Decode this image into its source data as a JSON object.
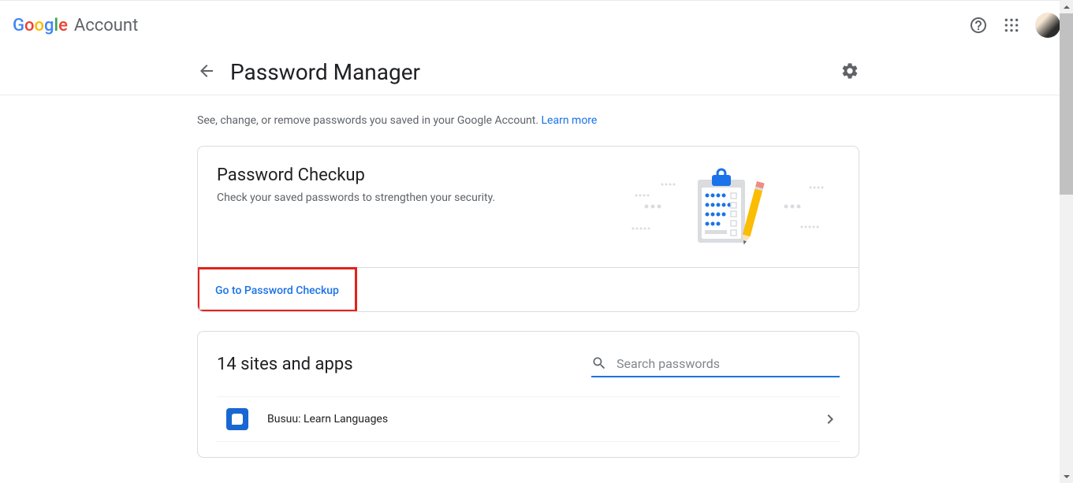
{
  "header": {
    "logo_text": "Google",
    "account_label": "Account"
  },
  "page": {
    "title": "Password Manager",
    "intro_text": "See, change, or remove passwords you saved in your Google Account. ",
    "intro_link": "Learn more"
  },
  "checkup": {
    "title": "Password Checkup",
    "subtitle": "Check your saved passwords to strengthen your security.",
    "cta": "Go to Password Checkup"
  },
  "sites": {
    "count_label": "14 sites and apps",
    "search_placeholder": "Search passwords",
    "items": [
      {
        "name": "Busuu: Learn Languages"
      }
    ]
  }
}
